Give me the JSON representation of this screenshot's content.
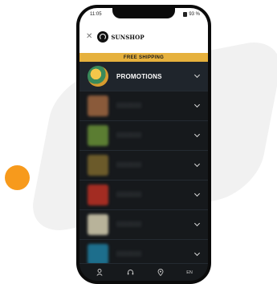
{
  "colors": {
    "accent": "#e6b13d",
    "orange": "#f79a1c",
    "screen_bg": "#16191c"
  },
  "status_bar": {
    "time": "11:05",
    "battery": "93 %"
  },
  "header": {
    "close_icon": "close-icon",
    "logo_text": "SUNSHOP"
  },
  "banner": {
    "text": "FREE SHIPPING"
  },
  "menu": {
    "items": [
      {
        "label": "PROMOTIONS",
        "thumb_color": "#d79b2e",
        "highlight": true,
        "blurred": false
      },
      {
        "label": "",
        "thumb_color": "#8a5a3a",
        "highlight": false,
        "blurred": true
      },
      {
        "label": "",
        "thumb_color": "#5b7d32",
        "highlight": false,
        "blurred": true
      },
      {
        "label": "",
        "thumb_color": "#6b5a2a",
        "highlight": false,
        "blurred": true
      },
      {
        "label": "",
        "thumb_color": "#a32c22",
        "highlight": false,
        "blurred": true
      },
      {
        "label": "",
        "thumb_color": "#b8b39a",
        "highlight": false,
        "blurred": true
      },
      {
        "label": "",
        "thumb_color": "#1d6e8c",
        "highlight": false,
        "blurred": true
      }
    ]
  },
  "bottom_nav": {
    "account_icon": "user-icon",
    "support_icon": "headset-icon",
    "location_icon": "location-pin-icon",
    "language": "EN"
  }
}
